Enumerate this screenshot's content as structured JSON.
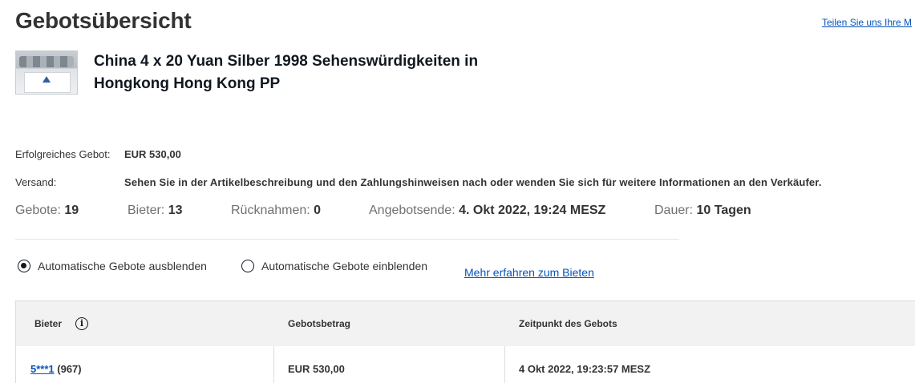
{
  "header": {
    "title": "Gebotsübersicht",
    "feedback_link": "Teilen Sie uns Ihre M"
  },
  "item": {
    "title": "China 4 x 20 Yuan Silber 1998 Sehenswürdigkeiten in Hongkong Hong Kong PP",
    "thumbnail_icon": "coin-set-thumbnail"
  },
  "details": {
    "winning_bid_label": "Erfolgreiches Gebot:",
    "winning_bid_value": "EUR 530,00",
    "shipping_label": "Versand:",
    "shipping_value": "Sehen Sie in der Artikelbeschreibung und den Zahlungshinweisen nach oder wenden Sie sich für weitere Informationen an den Verkäufer."
  },
  "stats": {
    "bids_label": "Gebote:",
    "bids_value": "19",
    "bidders_label": "Bieter:",
    "bidders_value": "13",
    "retractions_label": "Rücknahmen:",
    "retractions_value": "0",
    "end_label": "Angebotsende:",
    "end_value": "4. Okt 2022, 19:24 MESZ",
    "duration_label": "Dauer:",
    "duration_value": "10 Tagen"
  },
  "filters": {
    "hide_auto_label": "Automatische Gebote ausblenden",
    "show_auto_label": "Automatische Gebote einblenden",
    "selected": "hide_auto",
    "learn_more": "Mehr erfahren zum Bieten"
  },
  "table": {
    "headers": [
      "Bieter",
      "Gebotsbetrag",
      "Zeitpunkt des Gebots"
    ],
    "rows": [
      {
        "bidder": "5***1",
        "feedback": "(967)",
        "amount": "EUR 530,00",
        "time": "4 Okt 2022, 19:23:57 MESZ"
      }
    ]
  },
  "colors": {
    "link": "#0654ba",
    "header_bg": "#f2f2f2",
    "text": "#333333"
  }
}
